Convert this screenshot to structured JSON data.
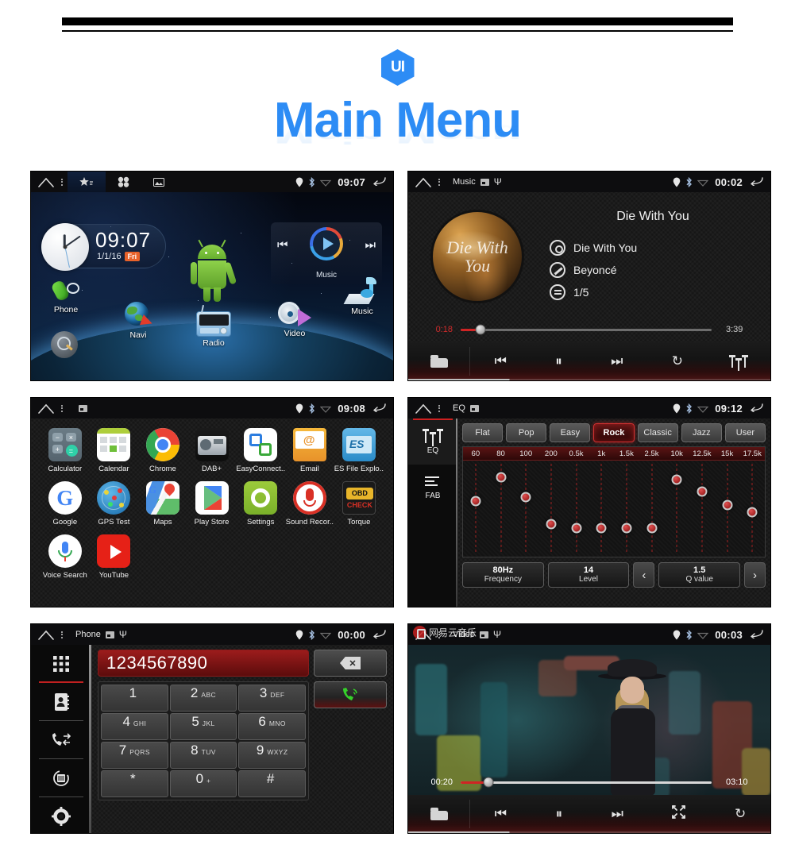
{
  "header": {
    "logo_text": "UI",
    "title": "Main Menu"
  },
  "screens": {
    "home": {
      "status": {
        "home_icon": "home-icon",
        "menu_icon": "overflow-menu-icon",
        "tab_favorites": "favorites-star-icon",
        "tab_apps": "apps-grid-icon",
        "tab_wallpaper": "wallpaper-icon",
        "location_icon": "location-pin-icon",
        "bluetooth_icon": "bluetooth-icon",
        "wifi_icon": "wifi-icon",
        "time": "09:07",
        "back_icon": "back-arrow-icon"
      },
      "clock": {
        "time": "09:07",
        "date": "1/1/16",
        "day": "Fri"
      },
      "music_widget": {
        "label": "Music",
        "prev": "⏮",
        "play": "play-icon",
        "next": "⏭"
      },
      "shortcuts": [
        {
          "label": "Phone"
        },
        {
          "label": "Navi"
        },
        {
          "label": "Radio"
        },
        {
          "label": "Video"
        },
        {
          "label": "Music"
        }
      ],
      "search_icon": "search-icon"
    },
    "music": {
      "status": {
        "title": "Music",
        "time": "00:02"
      },
      "album_art_text": "Die With You",
      "track_title": "Die With You",
      "meta": {
        "song": "Die With You",
        "artist": "Beyoncé",
        "index": "1/5"
      },
      "progress": {
        "current": "0:18",
        "total": "3:39",
        "percent": 8
      },
      "controls": {
        "folder": "folder-icon",
        "prev": "⏮",
        "pause": "⏸",
        "next": "⏭",
        "repeat": "↻",
        "eq": "equalizer-icon"
      }
    },
    "apps": {
      "status": {
        "time": "09:08",
        "wallpaper_icon": "wallpaper-icon"
      },
      "items": [
        {
          "label": "Calculator",
          "icon": "calculator-icon"
        },
        {
          "label": "Calendar",
          "icon": "calendar-icon"
        },
        {
          "label": "Chrome",
          "icon": "chrome-icon"
        },
        {
          "label": "DAB+",
          "icon": "dab-radio-icon"
        },
        {
          "label": "EasyConnect..",
          "icon": "easyconnect-icon"
        },
        {
          "label": "Email",
          "icon": "email-icon"
        },
        {
          "label": "ES File Explo..",
          "icon": "es-file-explorer-icon"
        },
        {
          "label": "Google",
          "icon": "google-icon"
        },
        {
          "label": "GPS Test",
          "icon": "gps-test-icon"
        },
        {
          "label": "Maps",
          "icon": "maps-icon"
        },
        {
          "label": "Play Store",
          "icon": "play-store-icon"
        },
        {
          "label": "Settings",
          "icon": "settings-gear-icon"
        },
        {
          "label": "Sound Recor..",
          "icon": "sound-recorder-icon"
        },
        {
          "label": "Torque",
          "icon": "torque-obd-icon"
        },
        {
          "label": "Voice Search",
          "icon": "voice-search-icon"
        },
        {
          "label": "YouTube",
          "icon": "youtube-icon"
        }
      ]
    },
    "eq": {
      "status": {
        "title": "EQ",
        "time": "09:12"
      },
      "sidebar": [
        {
          "label": "EQ",
          "selected": true
        },
        {
          "label": "FAB",
          "selected": false
        }
      ],
      "presets": [
        "Flat",
        "Pop",
        "Easy",
        "Rock",
        "Classic",
        "Jazz",
        "User"
      ],
      "active_preset": "Rock",
      "bands": [
        "60",
        "80",
        "100",
        "200",
        "0.5k",
        "1k",
        "1.5k",
        "2.5k",
        "10k",
        "12.5k",
        "15k",
        "17.5k"
      ],
      "band_positions": [
        42,
        17,
        38,
        66,
        70,
        70,
        70,
        70,
        20,
        32,
        46,
        54
      ],
      "values": [
        {
          "value": "80Hz",
          "name": "Frequency"
        },
        {
          "value": "14",
          "name": "Level"
        },
        {
          "value": "1.5",
          "name": "Q value"
        }
      ],
      "prev_arrow": "‹",
      "next_arrow": "›"
    },
    "phone": {
      "status": {
        "title": "Phone",
        "time": "00:00"
      },
      "sidebar": [
        {
          "icon": "dialpad-icon",
          "selected": true
        },
        {
          "icon": "contacts-book-icon",
          "selected": false
        },
        {
          "icon": "call-history-icon",
          "selected": false
        },
        {
          "icon": "sync-contacts-icon",
          "selected": false
        },
        {
          "icon": "settings-gear-icon",
          "selected": false
        }
      ],
      "number": "1234567890",
      "delete_icon": "backspace-icon",
      "call_icon": "call-icon",
      "keys": [
        {
          "num": "1",
          "letters": ""
        },
        {
          "num": "2",
          "letters": "ABC"
        },
        {
          "num": "3",
          "letters": "DEF"
        },
        {
          "num": "4",
          "letters": "GHI"
        },
        {
          "num": "5",
          "letters": "JKL"
        },
        {
          "num": "6",
          "letters": "MNO"
        },
        {
          "num": "7",
          "letters": "PQRS"
        },
        {
          "num": "8",
          "letters": "TUV"
        },
        {
          "num": "9",
          "letters": "WXYZ"
        },
        {
          "num": "*",
          "letters": ""
        },
        {
          "num": "0",
          "letters": "+"
        },
        {
          "num": "#",
          "letters": ""
        }
      ]
    },
    "video": {
      "status": {
        "title": "Video",
        "time": "00:03"
      },
      "watermark": "网易云音乐",
      "progress": {
        "current": "00:20",
        "total": "03:10",
        "percent": 11
      },
      "controls": {
        "folder": "folder-icon",
        "prev": "⏮",
        "pause": "⏸",
        "next": "⏭",
        "fullscreen": "fullscreen-icon",
        "repeat": "↻"
      }
    }
  },
  "colors": {
    "accent_blue": "#2d8cf5",
    "accent_red": "#cf2020",
    "status_bar": "#0d0d0f"
  }
}
